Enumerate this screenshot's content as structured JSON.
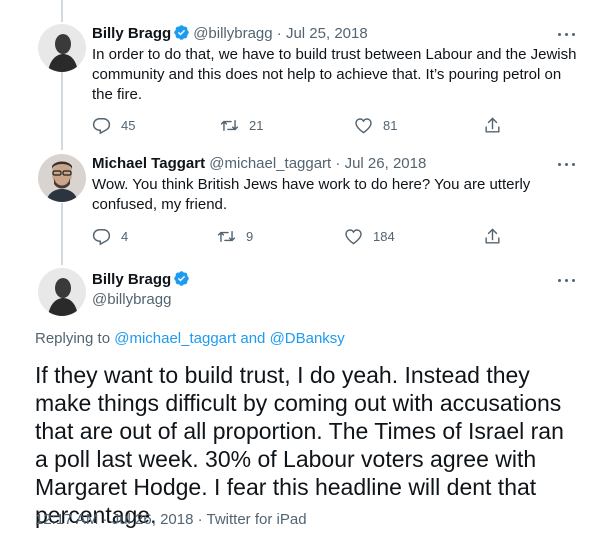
{
  "colors": {
    "accent": "#1d9bf0",
    "muted": "#536471",
    "text": "#0f1419",
    "thread_line": "#cfd9de"
  },
  "tweets": [
    {
      "name": "Billy Bragg",
      "verified": true,
      "handle": "@billybragg",
      "separator": "·",
      "date": "Jul 25, 2018",
      "text": "In order to do that, we have to build trust between Labour and the Jewish community and this does not help to achieve that. It’s pouring petrol on the fire.",
      "replies": "45",
      "retweets": "21",
      "likes": "81"
    },
    {
      "name": "Michael Taggart",
      "verified": false,
      "handle": "@michael_taggart",
      "separator": "·",
      "date": "Jul 26, 2018",
      "text": "Wow. You think British Jews have work to do here? You are utterly confused, my friend.",
      "replies": "4",
      "retweets": "9",
      "likes": "184"
    }
  ],
  "main_tweet": {
    "name": "Billy Bragg",
    "verified": true,
    "handle": "@billybragg",
    "replying_prefix": "Replying to",
    "replying_user1": "@michael_taggart",
    "replying_and": "and",
    "replying_user2": "@DBanksy",
    "text": "If they want to build trust, I do yeah. Instead they make things difficult by coming out with accusations that are out of all proportion. The Times of Israel ran a poll last week. 30% of Labour voters agree with Margaret Hodge. I fear this headline will dent that percentage.",
    "timestamp": "12:17 AM · Jul 26, 2018 · Twitter for iPad"
  },
  "icons": [
    "reply-icon",
    "retweet-icon",
    "like-icon",
    "share-icon",
    "more-icon",
    "verified-badge-icon"
  ]
}
